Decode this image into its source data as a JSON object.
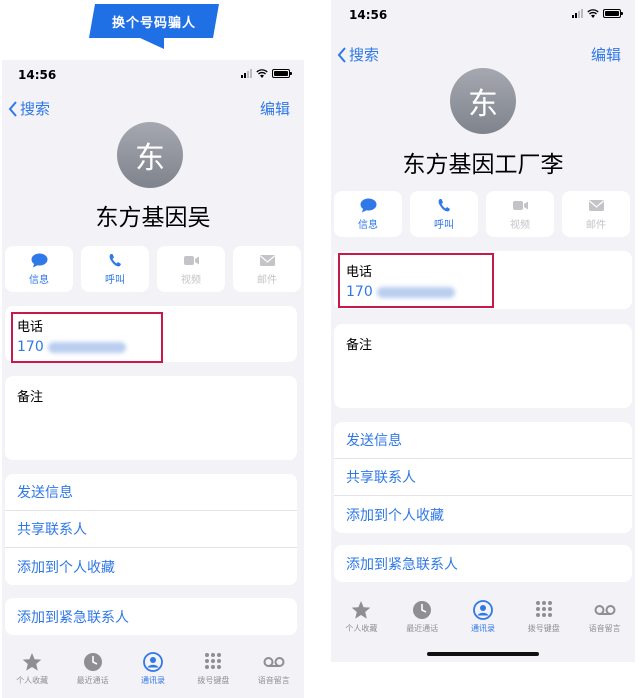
{
  "banner": {
    "text": "换个号码骗人"
  },
  "left_phone": {
    "status_time": "14:56",
    "nav": {
      "back_label": "搜索",
      "edit_label": "编辑"
    },
    "avatar_char": "东",
    "contact_name": "东方基因吴",
    "actions": [
      {
        "label": "信息",
        "icon": "message-icon",
        "enabled": true
      },
      {
        "label": "呼叫",
        "icon": "phone-icon",
        "enabled": true
      },
      {
        "label": "视频",
        "icon": "video-icon",
        "enabled": false
      },
      {
        "label": "邮件",
        "icon": "mail-icon",
        "enabled": false
      }
    ],
    "phone_field": {
      "label": "电话",
      "number_prefix": "170"
    },
    "notes_label": "备注",
    "menu": [
      "发送信息",
      "共享联系人",
      "添加到个人收藏"
    ],
    "emergency": "添加到紧急联系人",
    "tabs": [
      {
        "label": "个人收藏",
        "icon": "star-icon",
        "active": false
      },
      {
        "label": "最近通话",
        "icon": "clock-icon",
        "active": false
      },
      {
        "label": "通讯录",
        "icon": "contacts-icon",
        "active": true
      },
      {
        "label": "拨号键盘",
        "icon": "keypad-icon",
        "active": false
      },
      {
        "label": "语音留言",
        "icon": "voicemail-icon",
        "active": false
      }
    ]
  },
  "right_phone": {
    "status_time": "14:56",
    "nav": {
      "back_label": "搜索",
      "edit_label": "编辑"
    },
    "avatar_char": "东",
    "contact_name": "东方基因工厂李",
    "actions": [
      {
        "label": "信息",
        "icon": "message-icon",
        "enabled": true
      },
      {
        "label": "呼叫",
        "icon": "phone-icon",
        "enabled": true
      },
      {
        "label": "视频",
        "icon": "video-icon",
        "enabled": false
      },
      {
        "label": "邮件",
        "icon": "mail-icon",
        "enabled": false
      }
    ],
    "phone_field": {
      "label": "电话",
      "number_prefix": "170"
    },
    "notes_label": "备注",
    "menu": [
      "发送信息",
      "共享联系人",
      "添加到个人收藏"
    ],
    "emergency": "添加到紧急联系人",
    "tabs": [
      {
        "label": "个人收藏",
        "icon": "star-icon",
        "active": false
      },
      {
        "label": "最近通话",
        "icon": "clock-icon",
        "active": false
      },
      {
        "label": "通讯录",
        "icon": "contacts-icon",
        "active": true
      },
      {
        "label": "拨号键盘",
        "icon": "keypad-icon",
        "active": false
      },
      {
        "label": "语音留言",
        "icon": "voicemail-icon",
        "active": false
      }
    ]
  },
  "colors": {
    "accent": "#2f78e8",
    "highlight_box": "#c9184a",
    "banner": "#1f6fe5"
  }
}
